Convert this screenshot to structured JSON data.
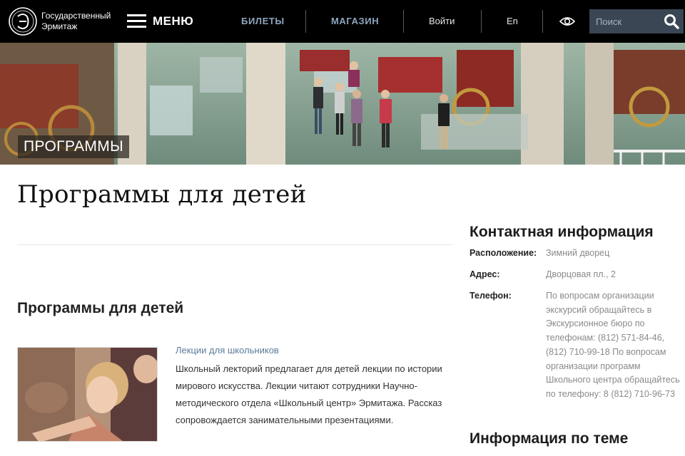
{
  "header": {
    "logo_line1": "Государственный",
    "logo_line2": "Эрмитаж",
    "menu_label": "МЕНЮ",
    "nav": {
      "tickets": "БИЛЕТЫ",
      "shop": "МАГАЗИН",
      "login": "Войти",
      "lang": "En"
    },
    "search_placeholder": "Поиск",
    "icons": {
      "logo": "hermitage-logo-icon",
      "menu": "hamburger-icon",
      "accessibility": "eye-icon",
      "search": "search-icon"
    }
  },
  "hero": {
    "badge": "ПРОГРАММЫ"
  },
  "main": {
    "title": "Программы для детей",
    "section_title": "Программы для детей",
    "card": {
      "link": "Лекции для школьников",
      "description": "Школьный лекторий предлагает для детей лекции по истории мирового искусства. Лекции читают сотрудники Научно-методического отдела «Школьный центр» Эрмитажа. Рассказ сопровождается занимательными презентациями."
    }
  },
  "sidebar": {
    "contact_title": "Контактная информация",
    "location_label": "Расположение:",
    "location_value": "Зимний дворец",
    "address_label": "Адрес:",
    "address_value": "Дворцовая пл., 2",
    "phone_label": "Телефон:",
    "phone_value": "По вопросам организации экскурсий обращайтесь в Экскурсионное бюро по телефонам: (812) 571-84-46, (812) 710-99-18 По вопросам организации программ Школьного центра обращайтесь по телефону: 8 (812) 710-96-73",
    "topic_title": "Информация по теме"
  },
  "colors": {
    "header_bg": "#000000",
    "nav_accent": "#8ea6bf",
    "search_bg": "#3b4654",
    "link": "#5a7c99",
    "muted": "#8a8a8a"
  }
}
